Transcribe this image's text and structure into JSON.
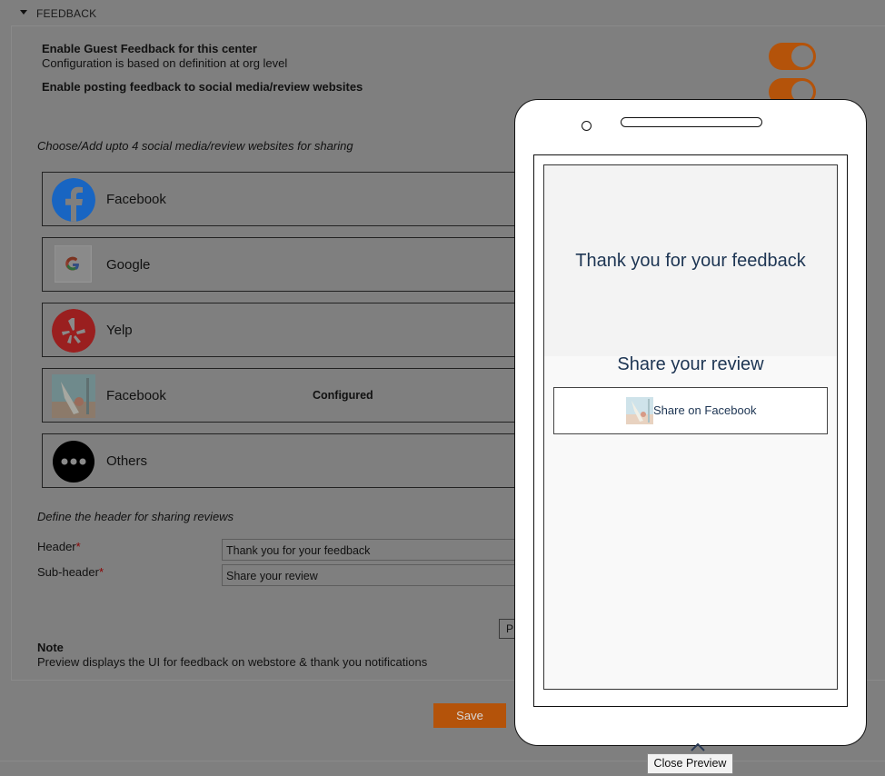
{
  "section": {
    "title": "FEEDBACK"
  },
  "settings": {
    "guest_feedback_label": "Enable Guest Feedback for this center",
    "guest_feedback_desc": "Configuration is based on definition at org level",
    "guest_feedback_enabled": true,
    "social_posting_label": "Enable posting feedback to social media/review websites",
    "social_posting_enabled": true
  },
  "sites": {
    "instruction": "Choose/Add upto 4 social media/review websites for sharing",
    "items": [
      {
        "label": "Facebook",
        "icon": "facebook-icon",
        "status": ""
      },
      {
        "label": "Google",
        "icon": "google-icon",
        "status": ""
      },
      {
        "label": "Yelp",
        "icon": "yelp-icon",
        "status": ""
      },
      {
        "label": "Facebook",
        "icon": "custom-image-icon",
        "status": "Configured"
      },
      {
        "label": "Others",
        "icon": "more-icon",
        "status": ""
      }
    ]
  },
  "header_config": {
    "instruction": "Define the header for sharing reviews",
    "header_label": "Header",
    "header_value": "Thank you for your feedback",
    "subheader_label": "Sub-header",
    "subheader_value": "Share your review",
    "required_mark": "*"
  },
  "preview_button_label": "P",
  "note": {
    "title": "Note",
    "text": "Preview displays the UI for feedback on webstore & thank you notifications"
  },
  "save_label": "Save",
  "phone_preview": {
    "title": "Thank you for your feedback",
    "subtitle": "Share your review",
    "share_button_label": "Share on Facebook"
  },
  "close_preview_label": "Close Preview",
  "colors": {
    "accent": "#b4530a",
    "overlay_bg": "#7f7f7f",
    "preview_text": "#1d3553",
    "facebook_blue": "#1877f2",
    "yelp_red": "#d32323"
  }
}
